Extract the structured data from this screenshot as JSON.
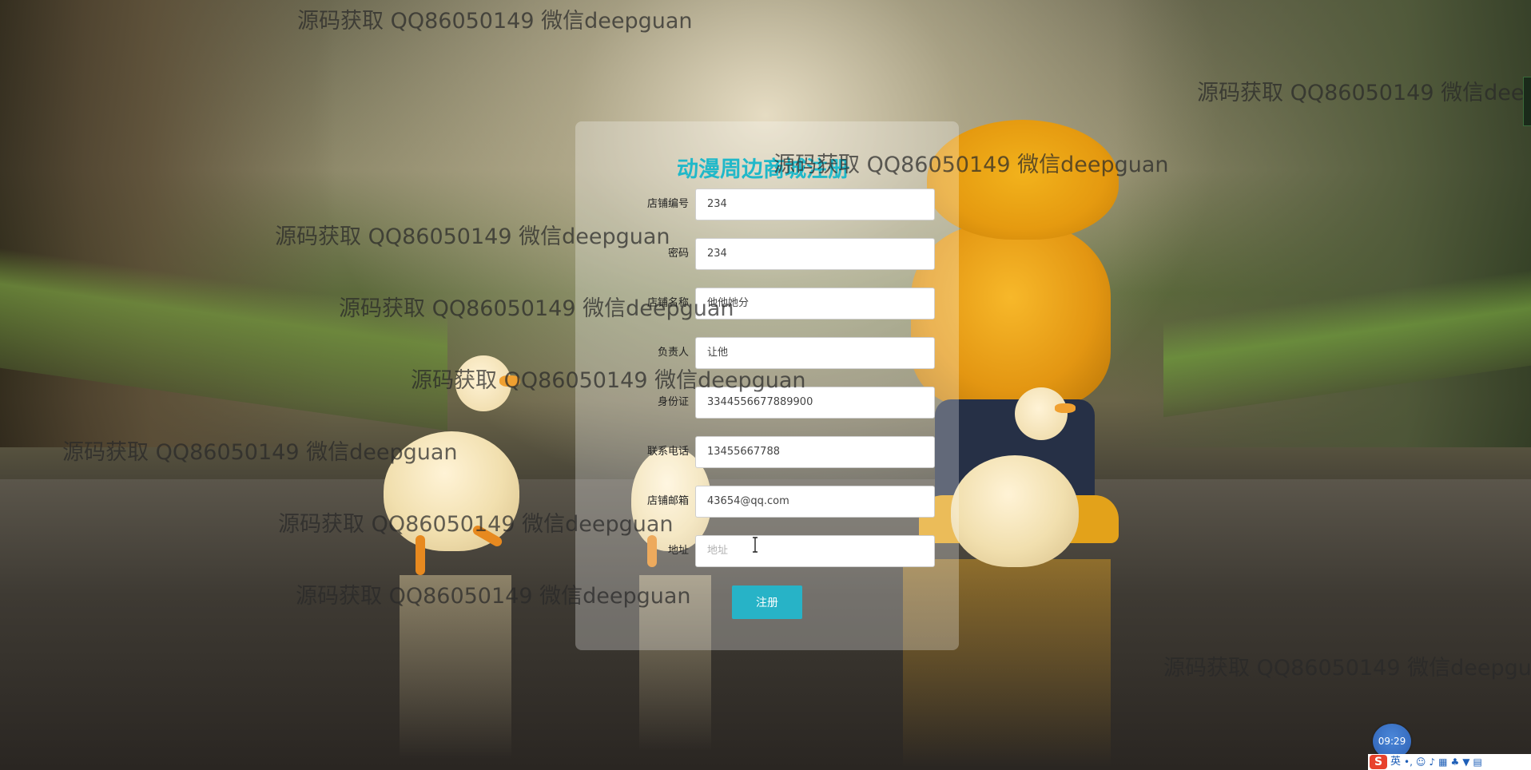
{
  "watermark": {
    "text": "源码获取 QQ86050149 微信deepguan"
  },
  "form": {
    "title": "动漫周边商城注册",
    "submit_label": "注册",
    "fields": [
      {
        "label": "店铺编号",
        "value": "234",
        "placeholder": ""
      },
      {
        "label": "密码",
        "value": "234",
        "placeholder": ""
      },
      {
        "label": "店铺名称",
        "value": "他他她分",
        "placeholder": ""
      },
      {
        "label": "负责人",
        "value": "让他",
        "placeholder": ""
      },
      {
        "label": "身份证",
        "value": "3344556677889900",
        "placeholder": ""
      },
      {
        "label": "联系电话",
        "value": "13455667788",
        "placeholder": ""
      },
      {
        "label": "店铺邮箱",
        "value": "43654@qq.com",
        "placeholder": ""
      },
      {
        "label": "地址",
        "value": "",
        "placeholder": "地址"
      }
    ]
  },
  "tray": {
    "time": "09:29",
    "ime_logo": "S",
    "ime_mode": "英",
    "icons": [
      "punctuation-icon",
      "emoji-icon",
      "microphone-icon",
      "keyboard-icon",
      "skin-icon",
      "shirt-icon",
      "grid-icon"
    ]
  }
}
